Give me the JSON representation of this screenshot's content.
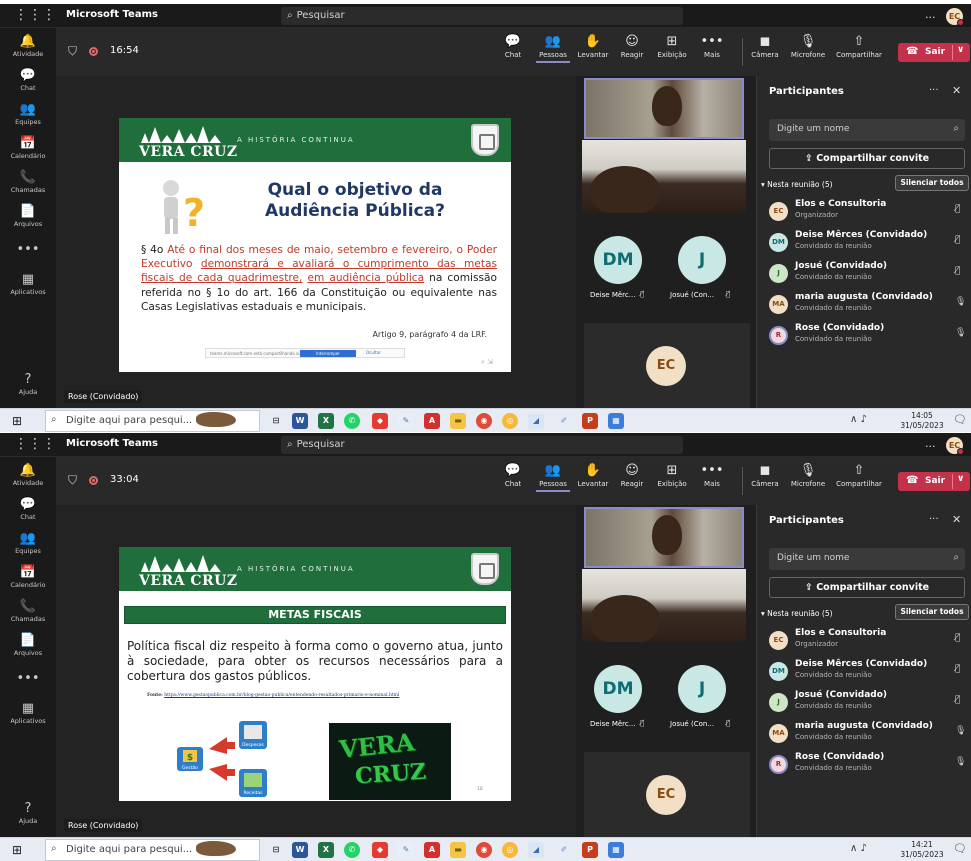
{
  "app": {
    "title": "Microsoft Teams",
    "search_placeholder": "Pesquisar",
    "more": "...",
    "avatar_initials": "EC"
  },
  "rail": [
    {
      "label": "Atividade",
      "icon": "bell-icon",
      "glyph": "🔔"
    },
    {
      "label": "Chat",
      "icon": "chat-icon",
      "glyph": "💬"
    },
    {
      "label": "Equipes",
      "icon": "teams-icon",
      "glyph": "👥"
    },
    {
      "label": "Calendário",
      "icon": "calendar-icon",
      "glyph": "📅"
    },
    {
      "label": "Chamadas",
      "icon": "phone-icon",
      "glyph": "📞"
    },
    {
      "label": "Arquivos",
      "icon": "file-icon",
      "glyph": "📄"
    },
    {
      "label": "",
      "icon": "more-icon",
      "glyph": "•••"
    },
    {
      "label": "Aplicativos",
      "icon": "apps-icon",
      "glyph": "▦"
    },
    {
      "label": "Ajuda",
      "icon": "help-icon",
      "glyph": "?"
    }
  ],
  "toolbar": {
    "chat": "Chat",
    "people": "Pessoas",
    "raise": "Levantar",
    "react": "Reagir",
    "view": "Exibição",
    "more": "Mais",
    "camera": "Câmera",
    "mic": "Microfone",
    "share": "Compartilhar",
    "leave": "Sair"
  },
  "panel": {
    "title": "Participantes",
    "search_placeholder": "Digite um nome",
    "share_invite": "Compartilhar convite",
    "section": "Nesta reunião (5)",
    "mute_all": "Silenciar todos",
    "participants": [
      {
        "initials": "EC",
        "name": "Elos e Consultoria",
        "role": "Organizador",
        "mic": "off"
      },
      {
        "initials": "DM",
        "name": "Deise Mêrces (Convidado)",
        "role": "Convidado da reunião",
        "mic": "off"
      },
      {
        "initials": "J",
        "name": "Josué (Convidado)",
        "role": "Convidado da reunião",
        "mic": "off"
      },
      {
        "initials": "MA",
        "name": "maria augusta (Convidado)",
        "role": "Convidado da reunião",
        "mic": "on"
      },
      {
        "initials": "R",
        "name": "Rose (Convidado)",
        "role": "Convidado da reunião",
        "mic": "on"
      }
    ]
  },
  "tiles": {
    "dm_initials": "DM",
    "dm_name": "Deise Mêrc...",
    "j_initials": "J",
    "j_name": "Josué (Con...",
    "self_initials": "EC"
  },
  "speaker_label": "Rose (Convidado)",
  "taskbar": {
    "search_placeholder": "Digite aqui para pesqui..."
  },
  "screens": [
    {
      "timer": "16:54",
      "clock_time": "14:05",
      "clock_date": "31/05/2023",
      "slide": {
        "brand": "VERA CRUZ",
        "tagline": "A HISTÓRIA CONTINUA",
        "title": "Qual o objetivo da Audiência Pública?",
        "body_1": "§ 4o ",
        "body_2": "Até o final dos meses de maio, setembro e fevereiro, o Poder Executivo ",
        "body_3": "demonstrará e avaliará o cumprimento das metas fiscais de cada quadrimestre,",
        "body_4": " ",
        "body_5": "em audiência pública",
        "body_6": " na comissão referida no § 1o do art. 166 da Constituição ou equivalente nas Casas Legislativas estaduais e municipais.",
        "footnote": "Artigo 9, parágrafo 4 da LRF.",
        "share_url": "teams.microsoft.com está compartilhando sua tela",
        "share_stop": "Interromper compartilhamento",
        "share_hide": "Ocultar"
      }
    },
    {
      "timer": "33:04",
      "clock_time": "14:21",
      "clock_date": "31/05/2023",
      "slide": {
        "brand": "VERA CRUZ",
        "tagline": "A HISTÓRIA CONTINUA",
        "heading": "METAS FISCAIS",
        "body": "Política fiscal diz respeito à forma como o governo atua, junto à sociedade, para obter os recursos necessários para a cobertura dos gastos públicos.",
        "source_label": "Fonte:",
        "source_url": "https://www.gestaopublica.com.br/blog-gestao-publica/entendendo-resultados-primario-e-nominal.html",
        "diagram_center": "Gestão",
        "diagram_top": "Despesas",
        "diagram_bottom": "Receitas",
        "photo_word_1": "VERA",
        "photo_word_2": "CRUZ",
        "page_no": "18"
      }
    }
  ],
  "colors": {
    "accent": "#8b8cc7",
    "leave": "#c4314b",
    "brand_green": "#1f6e3b",
    "title_blue": "#1f3864",
    "highlight_red": "#c0392b"
  }
}
